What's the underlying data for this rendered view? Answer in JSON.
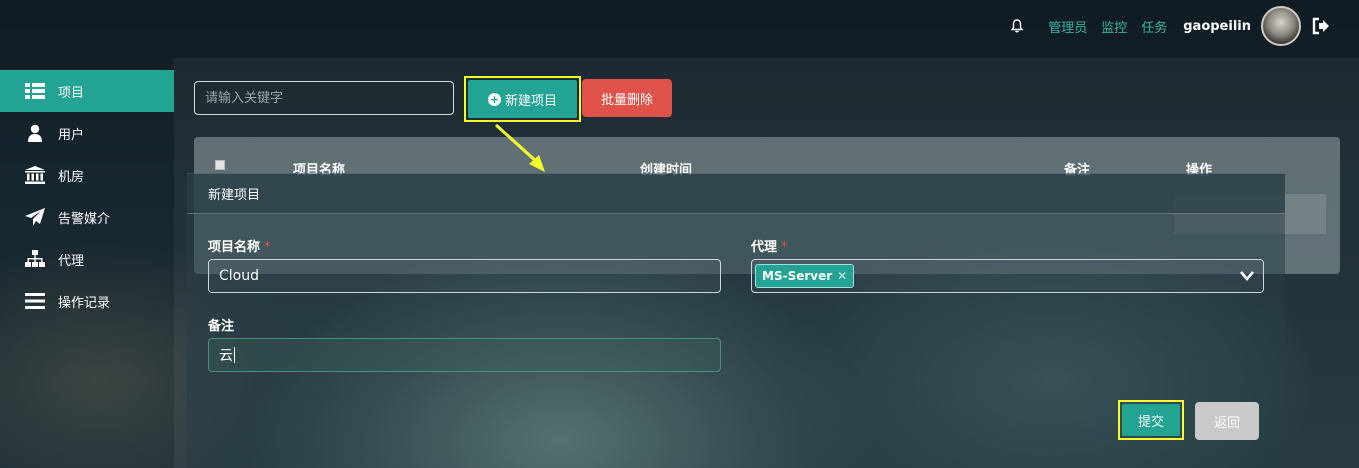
{
  "header": {
    "bell_icon": "bell-icon",
    "links": [
      "管理员",
      "监控",
      "任务"
    ],
    "username": "gaopeilin",
    "logout_icon": "logout-icon",
    "link_color": "#2fb5a0"
  },
  "sidebar": {
    "items": [
      {
        "label": "项目",
        "icon": "list-icon",
        "active": true
      },
      {
        "label": "用户",
        "icon": "user-icon",
        "active": false
      },
      {
        "label": "机房",
        "icon": "bank-icon",
        "active": false
      },
      {
        "label": "告警媒介",
        "icon": "send-icon",
        "active": false
      },
      {
        "label": "代理",
        "icon": "sitemap-icon",
        "active": false
      },
      {
        "label": "操作记录",
        "icon": "menu-icon",
        "active": false
      }
    ],
    "accent": "#22a393"
  },
  "toolbar": {
    "search_placeholder": "请输入关键字",
    "new_label": "新建项目",
    "delete_label": "批量删除",
    "delete_color": "#e0514a"
  },
  "table": {
    "columns": [
      "项目名称",
      "创建时间",
      "备注",
      "操作"
    ]
  },
  "modal": {
    "title": "新建项目",
    "name_label": "项目名称",
    "name_value": "Cloud",
    "proxy_label": "代理",
    "proxy_tag": "MS-Server",
    "remark_label": "备注",
    "remark_value": "云",
    "required_mark": "*",
    "submit_label": "提交",
    "back_label": "返回"
  }
}
